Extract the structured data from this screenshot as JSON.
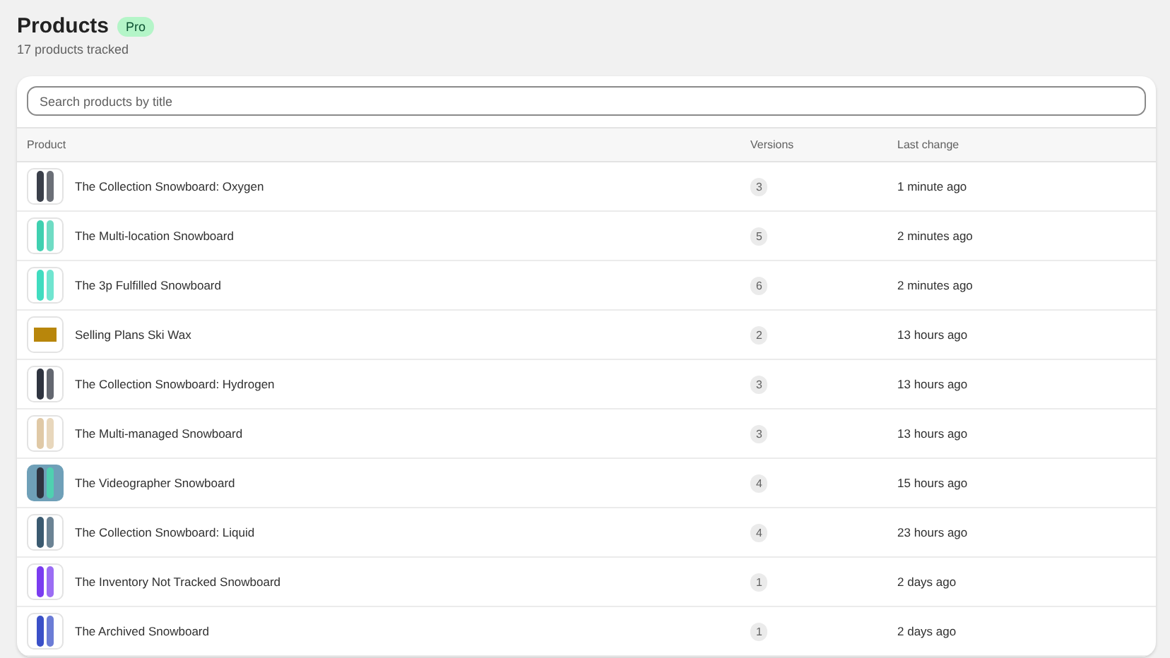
{
  "header": {
    "title": "Products",
    "badge": "Pro",
    "subtitle": "17 products tracked"
  },
  "search": {
    "placeholder": "Search products by title"
  },
  "table": {
    "columns": [
      "Product",
      "Versions",
      "Last change"
    ],
    "rows": [
      {
        "title": "The Collection Snowboard: Oxygen",
        "versions": "3",
        "last_change": "1 minute ago",
        "kind": "boards",
        "color": "#3a3f4a"
      },
      {
        "title": "The Multi-location Snowboard",
        "versions": "5",
        "last_change": "2 minutes ago",
        "kind": "boards",
        "color": "#3fd0b0"
      },
      {
        "title": "The 3p Fulfilled Snowboard",
        "versions": "6",
        "last_change": "2 minutes ago",
        "kind": "boards",
        "color": "#40dcc0"
      },
      {
        "title": "Selling Plans Ski Wax",
        "versions": "2",
        "last_change": "13 hours ago",
        "kind": "wax",
        "color": "#b8860b"
      },
      {
        "title": "The Collection Snowboard: Hydrogen",
        "versions": "3",
        "last_change": "13 hours ago",
        "kind": "boards",
        "color": "#2f3440"
      },
      {
        "title": "The Multi-managed Snowboard",
        "versions": "3",
        "last_change": "13 hours ago",
        "kind": "boards",
        "color": "#e0c9a6"
      },
      {
        "title": "The Videographer Snowboard",
        "versions": "4",
        "last_change": "15 hours ago",
        "kind": "photo",
        "color": "#6fa0b8"
      },
      {
        "title": "The Collection Snowboard: Liquid",
        "versions": "4",
        "last_change": "23 hours ago",
        "kind": "boards",
        "color": "#3a5a70"
      },
      {
        "title": "The Inventory Not Tracked Snowboard",
        "versions": "1",
        "last_change": "2 days ago",
        "kind": "boards",
        "color": "#7a3cf0"
      },
      {
        "title": "The Archived Snowboard",
        "versions": "1",
        "last_change": "2 days ago",
        "kind": "boards",
        "color": "#3a50c8"
      }
    ]
  }
}
